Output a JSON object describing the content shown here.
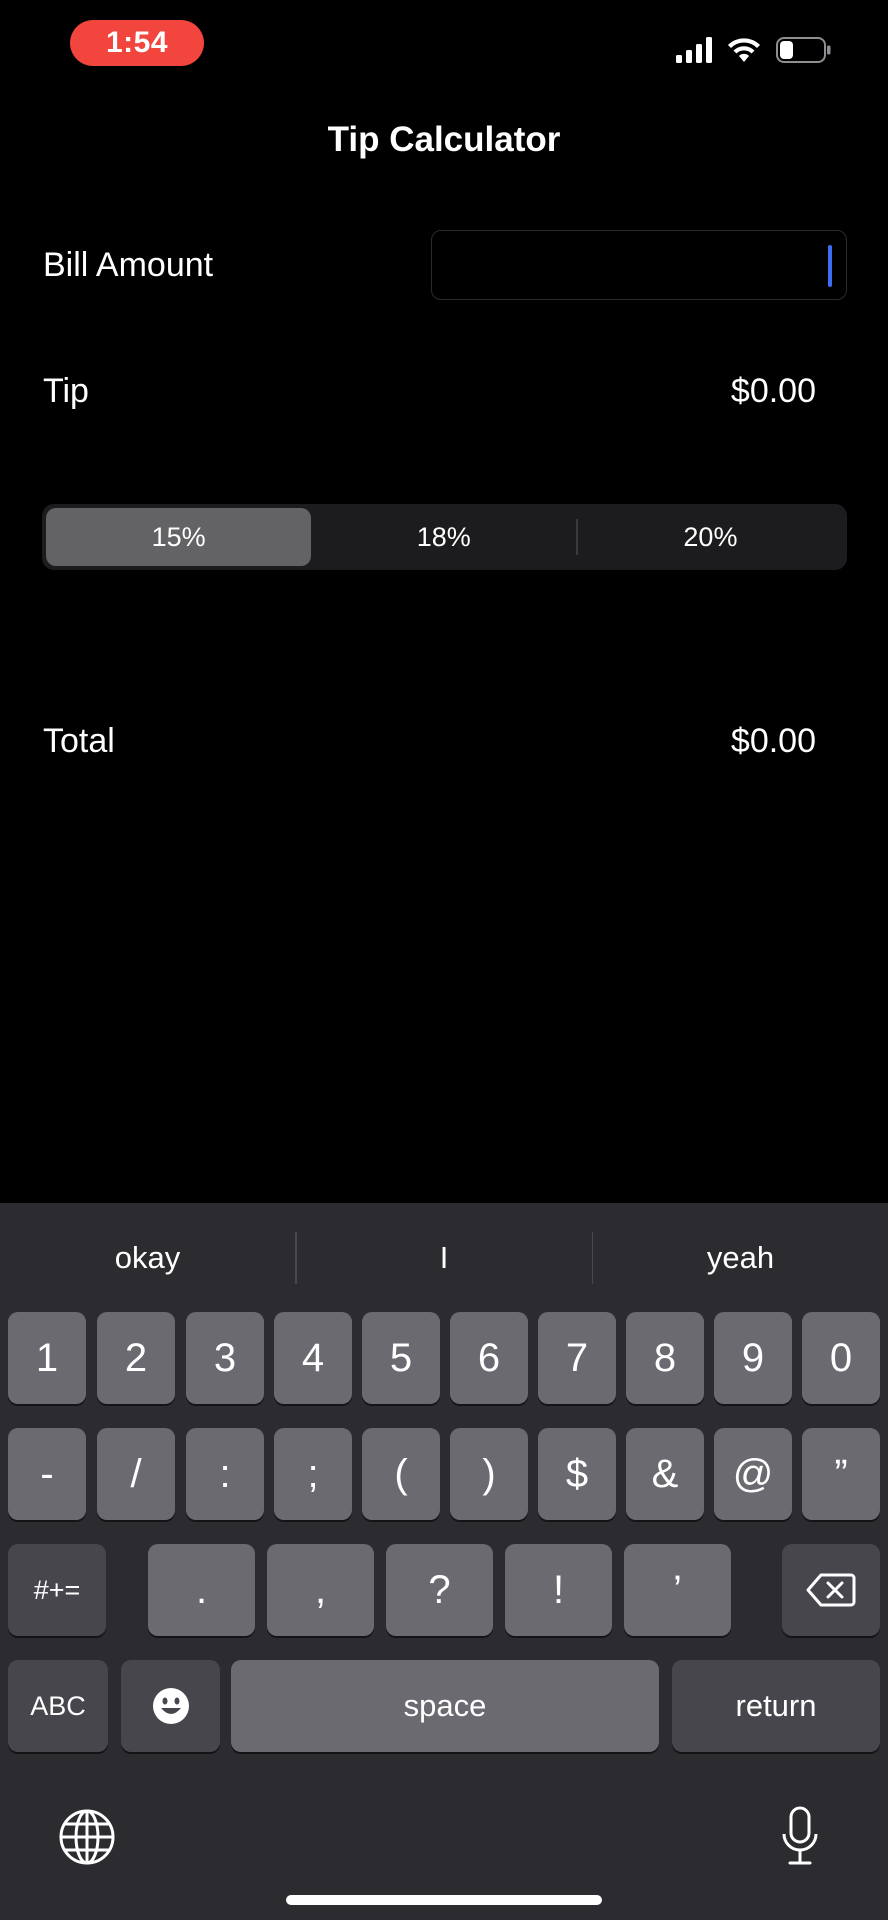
{
  "status_bar": {
    "time": "1:54"
  },
  "nav": {
    "title": "Tip Calculator"
  },
  "bill": {
    "label": "Bill Amount",
    "value": ""
  },
  "tip": {
    "label": "Tip",
    "value": "$0.00"
  },
  "segments": {
    "options": [
      "15%",
      "18%",
      "20%"
    ],
    "selected": "15%"
  },
  "total": {
    "label": "Total",
    "value": "$0.00"
  },
  "keyboard": {
    "suggestions": [
      "okay",
      "I",
      "yeah"
    ],
    "row1": [
      "1",
      "2",
      "3",
      "4",
      "5",
      "6",
      "7",
      "8",
      "9",
      "0"
    ],
    "row2": [
      "-",
      "/",
      ":",
      ";",
      "(",
      ")",
      "$",
      "&",
      "@",
      "”"
    ],
    "row3": [
      "#+=",
      ".",
      ",",
      "?",
      "!",
      "’"
    ],
    "row4": {
      "abc": "ABC",
      "space": "space",
      "return": "return"
    }
  }
}
